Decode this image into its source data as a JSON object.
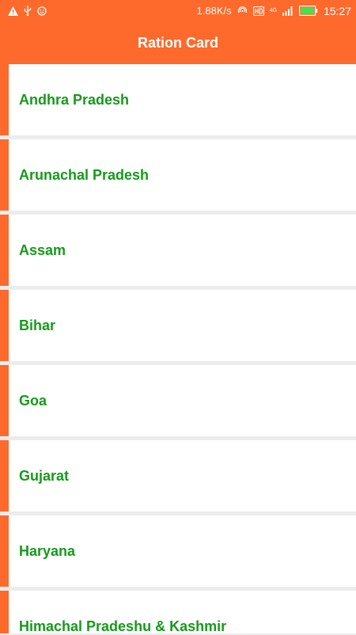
{
  "status_bar": {
    "network_speed": "1.88K/s",
    "network_type": "4G",
    "time": "15:27",
    "icons_left": [
      "warning-icon",
      "usb-icon",
      "emoji-icon"
    ],
    "icons_right": [
      "hotspot-icon",
      "hd-icon",
      "signal-icon",
      "battery-icon"
    ]
  },
  "app_bar": {
    "title": "Ration Card"
  },
  "states": [
    {
      "label": "Andhra Pradesh"
    },
    {
      "label": "Arunachal Pradesh"
    },
    {
      "label": "Assam"
    },
    {
      "label": "Bihar"
    },
    {
      "label": "Goa"
    },
    {
      "label": "Gujarat"
    },
    {
      "label": "Haryana"
    },
    {
      "label": "Himachal Pradeshu & Kashmir"
    }
  ],
  "colors": {
    "accent": "#fd6a2c",
    "item_text": "#159a1a",
    "background": "#ececec",
    "card": "#ffffff"
  }
}
